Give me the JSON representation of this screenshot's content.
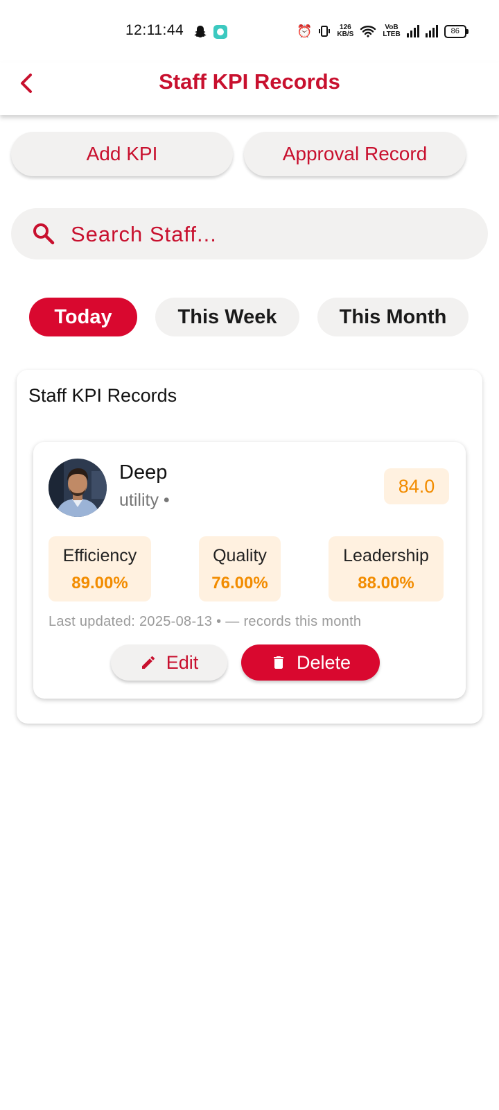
{
  "status_bar": {
    "time": "12:11:44",
    "net_speed_value": "126",
    "net_speed_unit": "KB/S",
    "volte_top": "VoB",
    "volte_bottom": "LTEB",
    "battery": "86"
  },
  "app_bar": {
    "title": "Staff KPI Records",
    "back_icon": "chevron-left-icon"
  },
  "actions": {
    "add_kpi": "Add KPI",
    "approval_record": "Approval Record"
  },
  "search": {
    "placeholder": "Search Staff...",
    "value": ""
  },
  "filters": [
    {
      "label": "Today",
      "active": true
    },
    {
      "label": "This Week",
      "active": false
    },
    {
      "label": "This Month",
      "active": false
    }
  ],
  "records_card": {
    "title": "Staff KPI Records",
    "record": {
      "name": "Deep",
      "department": "utility •",
      "score": "84.0",
      "metrics": [
        {
          "label": "Efficiency",
          "value": "89.00%"
        },
        {
          "label": "Quality",
          "value": "76.00%"
        },
        {
          "label": "Leadership",
          "value": "88.00%"
        }
      ],
      "last_updated": "Last updated: 2025-08-13 • — records this month",
      "edit_label": "Edit",
      "delete_label": "Delete"
    }
  },
  "colors": {
    "brand_red": "#c8102e",
    "active_chip": "#d9082f",
    "accent_orange": "#f28c00",
    "metric_bg": "#fff1e0",
    "pill_bg": "#f2f1f0"
  }
}
